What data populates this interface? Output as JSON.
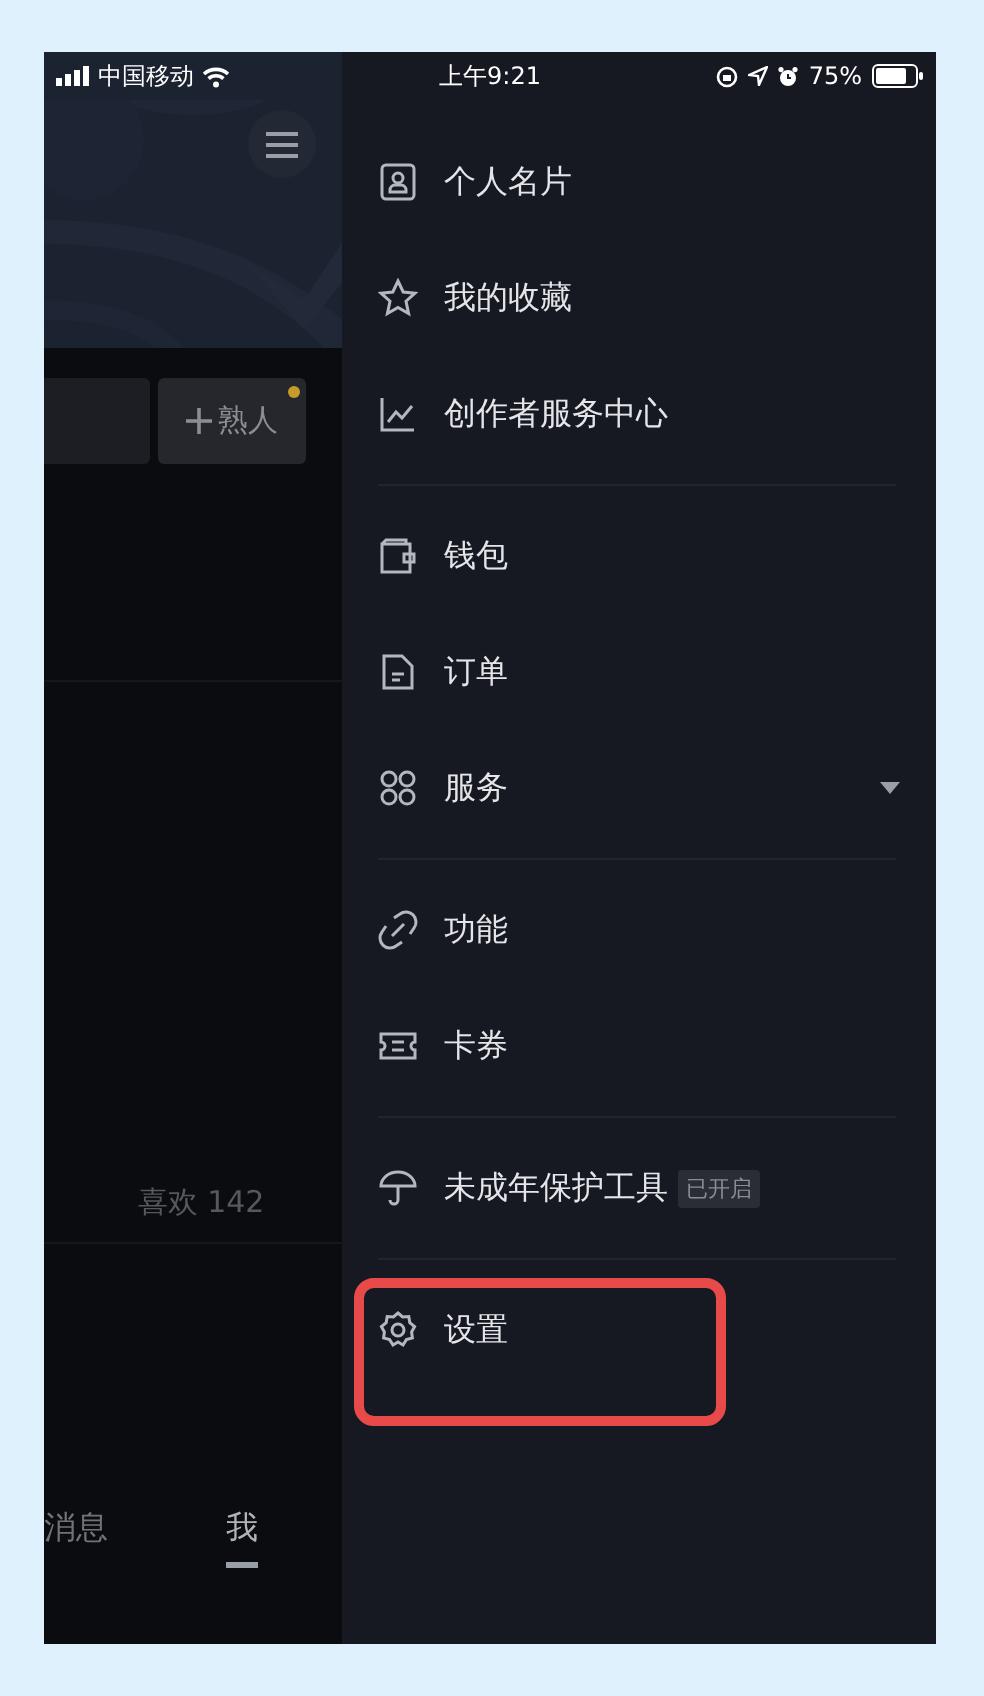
{
  "status_bar": {
    "carrier": "中国移动",
    "time": "上午9:21",
    "battery": "75%"
  },
  "profile_panel": {
    "friend_button": {
      "label": "熟人",
      "new_dot": true
    },
    "likes": "喜欢 142"
  },
  "tabs": [
    {
      "label": "消息",
      "selected": false
    },
    {
      "label": "我",
      "selected": true
    }
  ],
  "drawer": {
    "sections": [
      {
        "items": [
          {
            "label": "个人名片"
          },
          {
            "label": "我的收藏"
          },
          {
            "label": "创作者服务中心"
          }
        ]
      },
      {
        "items": [
          {
            "label": "钱包"
          },
          {
            "label": "订单"
          },
          {
            "label": "服务",
            "expandable": true
          }
        ]
      },
      {
        "items": [
          {
            "label": "功能"
          },
          {
            "label": "卡券"
          }
        ]
      },
      {
        "items": [
          {
            "label": "未成年保护工具",
            "badge": "已开启"
          }
        ]
      },
      {
        "items": [
          {
            "label": "设置",
            "highlighted": true
          }
        ]
      }
    ]
  }
}
